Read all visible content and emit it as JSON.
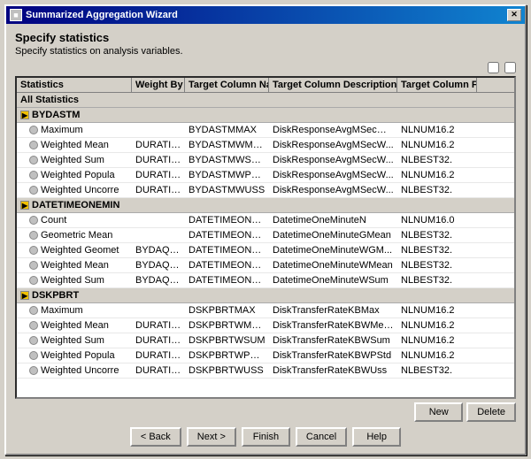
{
  "window": {
    "title": "Summarized Aggregation Wizard",
    "close_label": "✕"
  },
  "header": {
    "title": "Specify statistics",
    "subtitle": "Specify statistics on analysis variables."
  },
  "table": {
    "columns": [
      {
        "id": "statistics",
        "label": "Statistics"
      },
      {
        "id": "weight_by",
        "label": "Weight By"
      },
      {
        "id": "target_column",
        "label": "Target Column Name"
      },
      {
        "id": "target_desc",
        "label": "Target Column Description"
      },
      {
        "id": "target_format",
        "label": "Target Column Format"
      }
    ],
    "groups": [
      {
        "type": "all",
        "label": "All Statistics",
        "rows": []
      },
      {
        "type": "group",
        "label": "BYDASTM",
        "rows": [
          {
            "stat": "Maximum",
            "weight": "",
            "target": "BYDASTMMAX",
            "desc": "DiskResponseAvgMSecMax",
            "format": "NLNUM16.2"
          },
          {
            "stat": "Weighted Mean",
            "weight": "DURATION",
            "target": "BYDASTMWMEAN",
            "desc": "DiskResponseAvgMSecW...",
            "format": "NLNUM16.2"
          },
          {
            "stat": "Weighted Sum",
            "weight": "DURATION",
            "target": "BYDASTMWSUM",
            "desc": "DiskResponseAvgMSecW...",
            "format": "NLBEST32."
          },
          {
            "stat": "Weighted Popula",
            "weight": "DURATION",
            "target": "BYDASTMWPSTD",
            "desc": "DiskResponseAvgMSecW...",
            "format": "NLNUM16.2"
          },
          {
            "stat": "Weighted Uncorre",
            "weight": "DURATION",
            "target": "BYDASTMWUSS",
            "desc": "DiskResponseAvgMSecW...",
            "format": "NLBEST32."
          }
        ]
      },
      {
        "type": "group",
        "label": "DATETIMEONEMIN",
        "rows": [
          {
            "stat": "Count",
            "weight": "",
            "target": "DATETIMEONEMINN",
            "desc": "DatetimeOneMinuteN",
            "format": "NLNUM16.0"
          },
          {
            "stat": "Geometric Mean",
            "weight": "",
            "target": "DATETIMEONEMINN...",
            "desc": "DatetimeOneMinuteGMean",
            "format": "NLBEST32."
          },
          {
            "stat": "Weighted Geomet",
            "weight": "BYDAQRD",
            "target": "DATETIMEONEMINN...",
            "desc": "DatetimeOneMinuteWGM...",
            "format": "NLBEST32."
          },
          {
            "stat": "Weighted Mean",
            "weight": "BYDAQRD",
            "target": "DATETIMEONEMINN...",
            "desc": "DatetimeOneMinuteWMean",
            "format": "NLBEST32."
          },
          {
            "stat": "Weighted Sum",
            "weight": "BYDAQRD",
            "target": "DATETIMEONEMINN...",
            "desc": "DatetimeOneMinuteWSum",
            "format": "NLBEST32."
          }
        ]
      },
      {
        "type": "group",
        "label": "DSKPBRT",
        "rows": [
          {
            "stat": "Maximum",
            "weight": "",
            "target": "DSKPBRTMAX",
            "desc": "DiskTransferRateKBMax",
            "format": "NLNUM16.2"
          },
          {
            "stat": "Weighted Mean",
            "weight": "DURATION",
            "target": "DSKPBRTWMEAN",
            "desc": "DiskTransferRateKBWMean",
            "format": "NLNUM16.2"
          },
          {
            "stat": "Weighted Sum",
            "weight": "DURATION",
            "target": "DSKPBRTWSUM",
            "desc": "DiskTransferRateKBWSum",
            "format": "NLNUM16.2"
          },
          {
            "stat": "Weighted Popula",
            "weight": "DURATION",
            "target": "DSKPBRTWPSTD",
            "desc": "DiskTransferRateKBWPStd",
            "format": "NLNUM16.2"
          },
          {
            "stat": "Weighted Uncorre",
            "weight": "DURATION",
            "target": "DSKPBRTWUSS",
            "desc": "DiskTransferRateKBWUss",
            "format": "NLBEST32."
          }
        ]
      }
    ]
  },
  "buttons": {
    "new_label": "New",
    "delete_label": "Delete",
    "back_label": "< Back",
    "next_label": "Next >",
    "finish_label": "Finish",
    "cancel_label": "Cancel",
    "help_label": "Help"
  }
}
